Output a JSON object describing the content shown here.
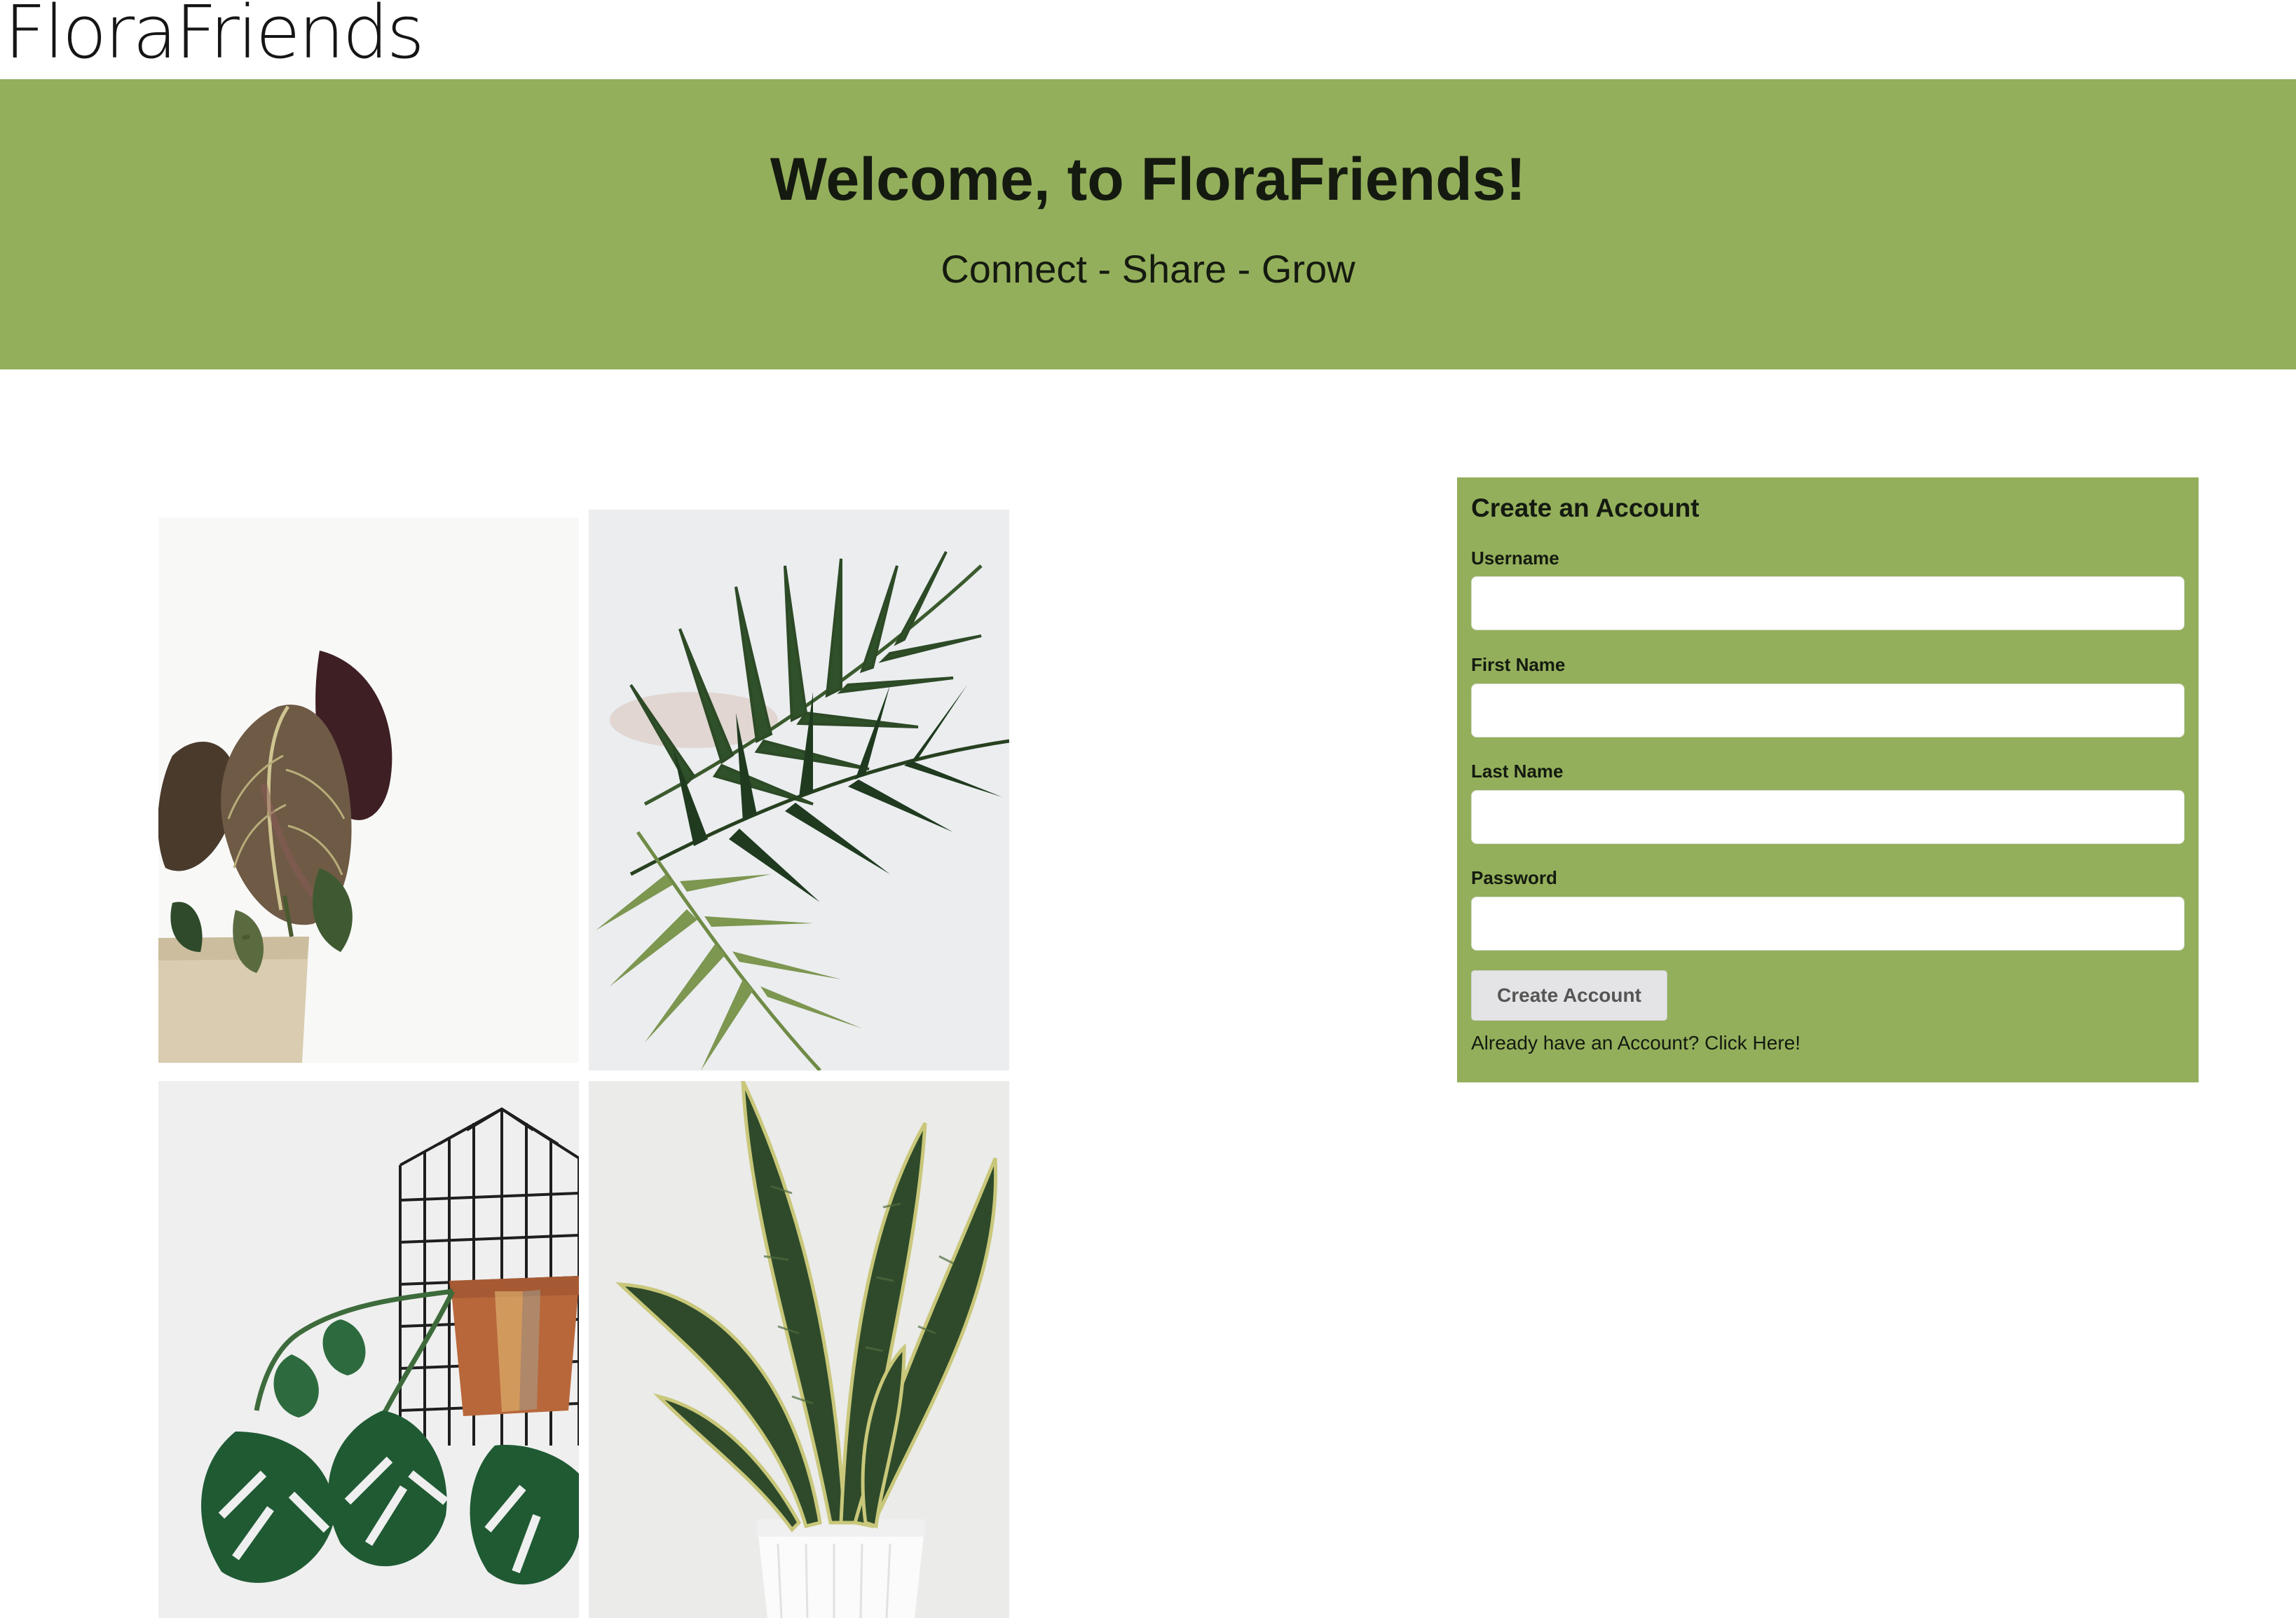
{
  "header": {
    "logo_text": "FloraFriends"
  },
  "hero": {
    "title": "Welcome, to FloraFriends!",
    "subtitle": "Connect - Share - Grow",
    "background_color": "#93af5b"
  },
  "gallery": {
    "images": [
      {
        "subject": "alocasia-plant-in-pot"
      },
      {
        "subject": "palm-fronds"
      },
      {
        "subject": "monstera-with-terracotta-pot-and-wire-rack"
      },
      {
        "subject": "snake-plant-in-white-pot"
      }
    ]
  },
  "signup_form": {
    "title": "Create an Account",
    "fields": [
      {
        "label": "Username",
        "value": "",
        "placeholder": ""
      },
      {
        "label": "First Name",
        "value": "",
        "placeholder": ""
      },
      {
        "label": "Last Name",
        "value": "",
        "placeholder": ""
      },
      {
        "label": "Password",
        "value": "",
        "placeholder": ""
      }
    ],
    "submit_label": "Create Account",
    "login_link": "Already have an Account? Click Here!",
    "card_color": "#93af5b"
  }
}
